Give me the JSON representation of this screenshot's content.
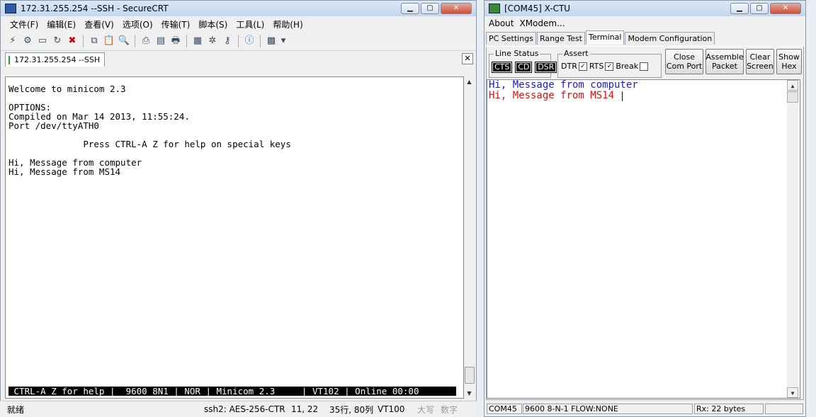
{
  "securecrt": {
    "title": "172.31.255.254 --SSH - SecureCRT",
    "menu": [
      "文件(F)",
      "编辑(E)",
      "查看(V)",
      "选项(O)",
      "传输(T)",
      "脚本(S)",
      "工具(L)",
      "帮助(H)"
    ],
    "tab_label": "172.31.255.254 --SSH",
    "terminal_lines": [
      "Welcome to minicom 2.3",
      "",
      "OPTIONS:",
      "Compiled on Mar 14 2013, 11:55:24.",
      "Port /dev/ttyATH0",
      "",
      "              Press CTRL-A Z for help on special keys",
      "",
      "Hi, Message from computer",
      "Hi, Message from MS14"
    ],
    "terminal_status": " CTRL-A Z for help |  9600 8N1 | NOR | Minicom 2.3     | VT102 | Online 00:00",
    "status": {
      "ready": "就绪",
      "cipher": "ssh2: AES-256-CTR",
      "cursor": "11,  22",
      "size": "35行, 80列",
      "emulation": "VT100",
      "caps": "大写",
      "num": "数字"
    }
  },
  "xctu": {
    "title": "[COM45] X-CTU",
    "menu": [
      "About",
      "XModem..."
    ],
    "tabs": [
      "PC Settings",
      "Range Test",
      "Terminal",
      "Modem Configuration"
    ],
    "active_tab": "Terminal",
    "line_status": {
      "label": "Line Status",
      "indicators": [
        "CTS",
        "CD",
        "DSR"
      ]
    },
    "assert": {
      "label": "Assert",
      "dtr": "DTR",
      "rts": "RTS",
      "brk": "Break"
    },
    "buttons": {
      "close_com": [
        "Close",
        "Com Port"
      ],
      "assemble": [
        "Assemble",
        "Packet"
      ],
      "clear": [
        "Clear",
        "Screen"
      ],
      "show_hex": [
        "Show",
        "Hex"
      ]
    },
    "terminal": {
      "line1": "Hi, Message from computer",
      "line2": "Hi, Message from MS14"
    },
    "colors": {
      "sent": "#1a1acc",
      "received": "#dd1111"
    },
    "status": {
      "port": "COM45",
      "settings": "9600 8-N-1  FLOW:NONE",
      "rx": "Rx: 22 bytes"
    }
  }
}
